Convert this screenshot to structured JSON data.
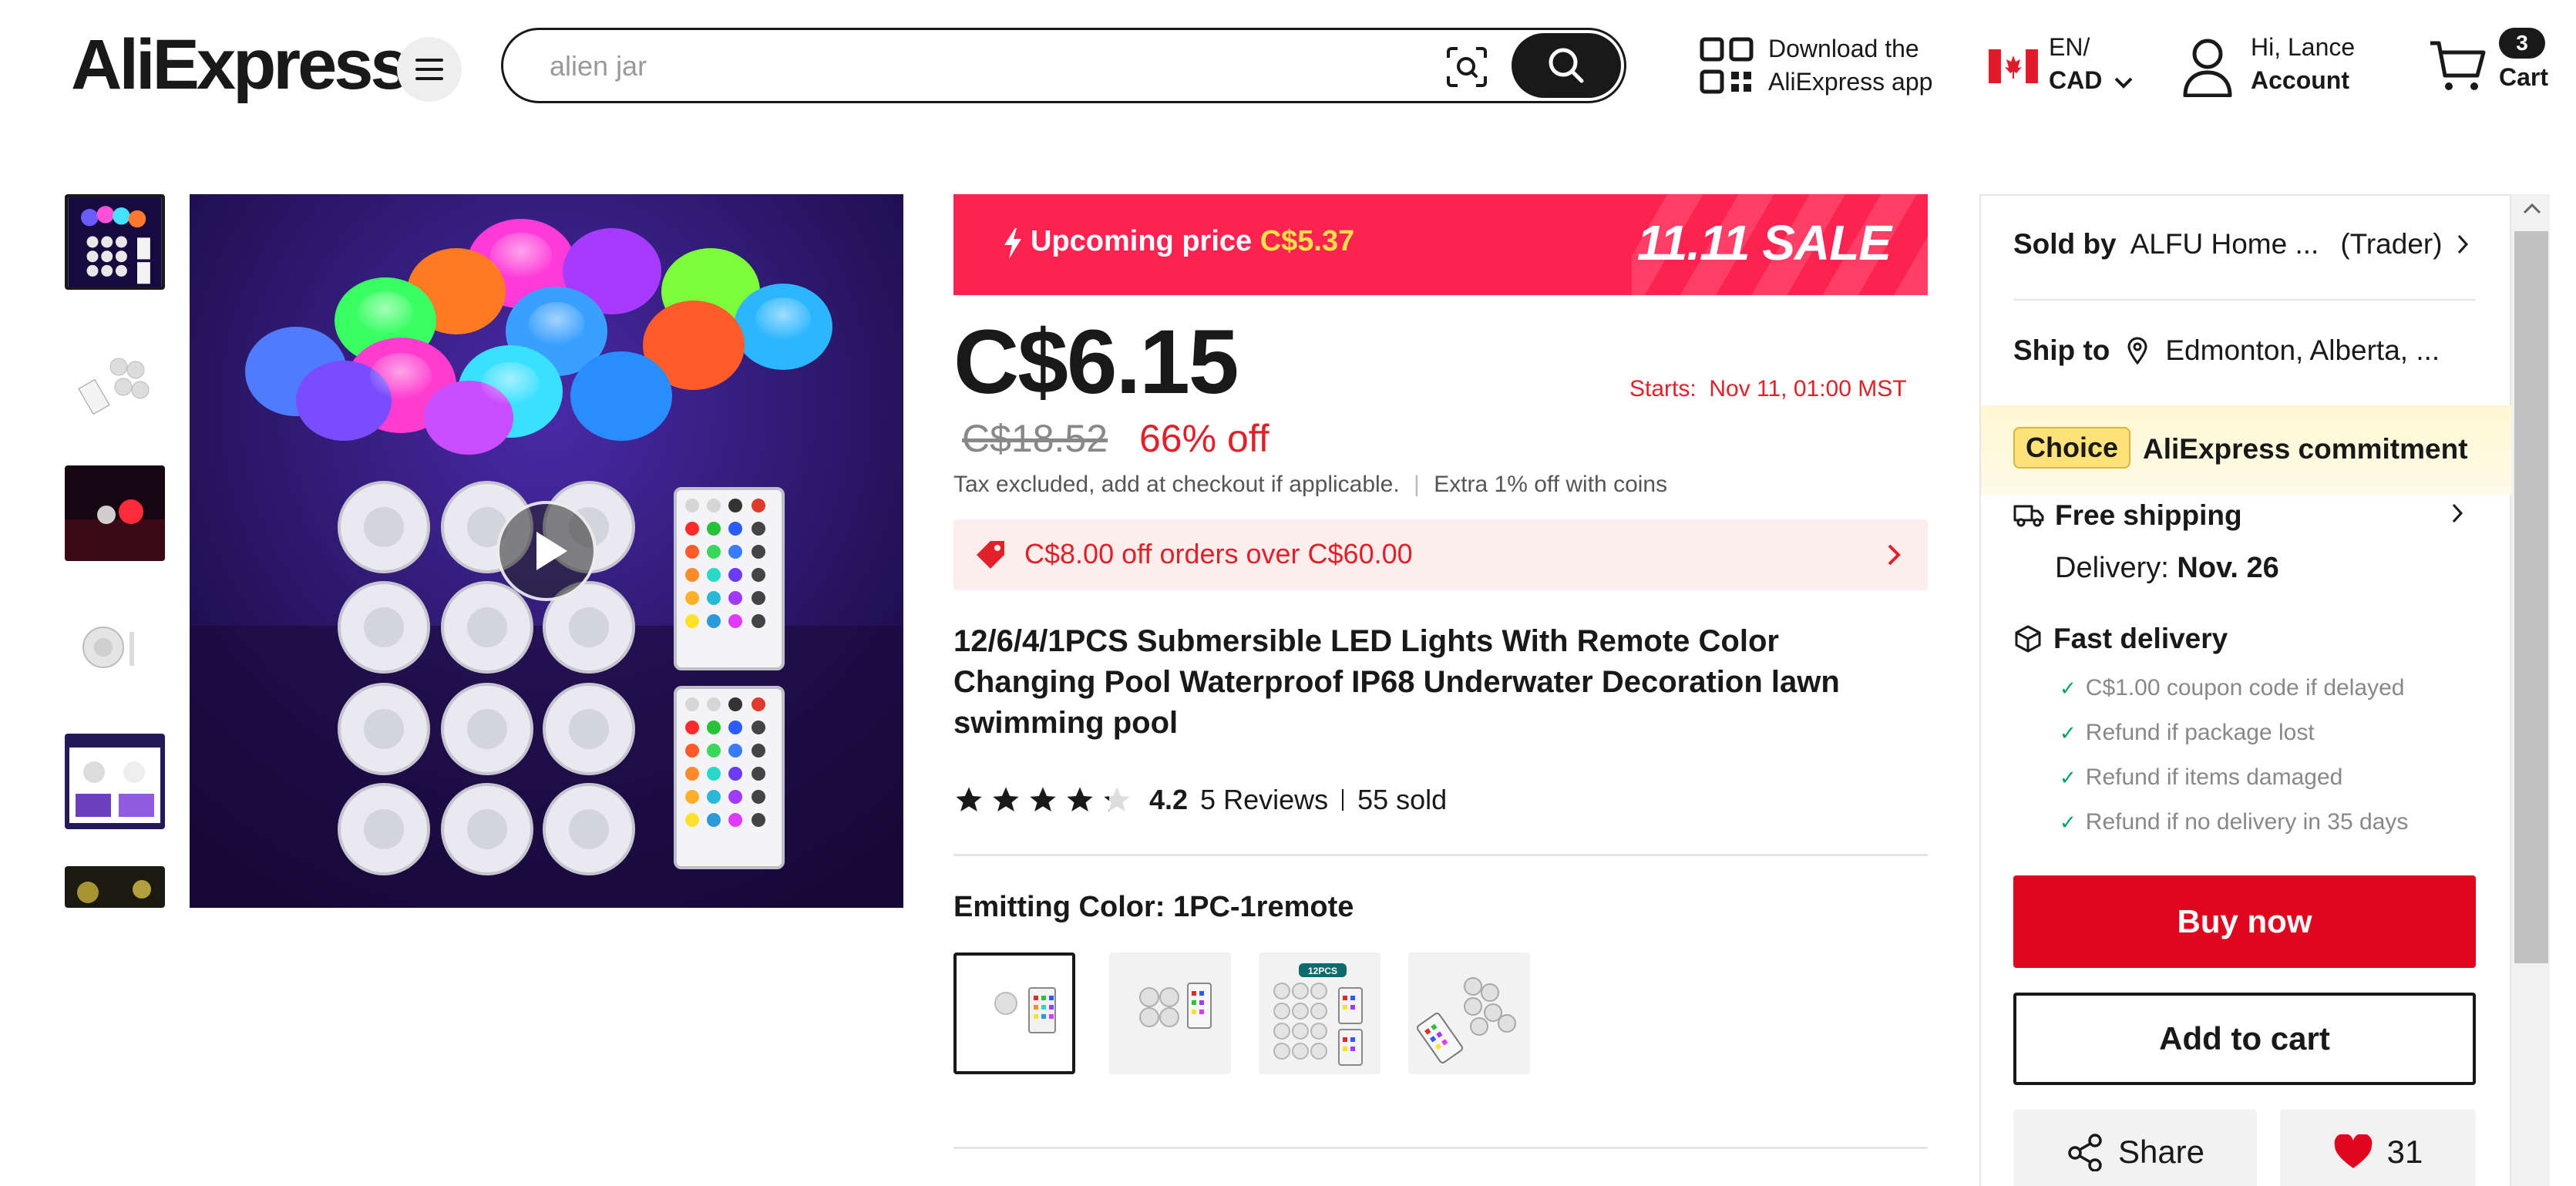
{
  "header": {
    "logo_text": "AliExpress",
    "menu_icon": "hamburger-menu-icon",
    "search": {
      "placeholder": "alien jar",
      "scan_icon": "image-search-icon",
      "button_icon": "search-icon"
    },
    "app_download": {
      "line1": "Download the",
      "line2": "AliExpress app",
      "icon": "qr-code-icon"
    },
    "locale": {
      "lang": "EN/",
      "currency": "CAD",
      "flag": "canada-flag-icon"
    },
    "account": {
      "greeting": "Hi, Lance",
      "label": "Account",
      "icon": "user-icon"
    },
    "cart": {
      "count": "3",
      "label": "Cart",
      "icon": "cart-icon"
    }
  },
  "gallery": {
    "thumbnails": [
      "thumb-1",
      "thumb-2",
      "thumb-3",
      "thumb-4",
      "thumb-5",
      "thumb-6"
    ],
    "active_index": 0,
    "play_icon": "play-icon"
  },
  "product": {
    "sale_banner": {
      "label": "Upcoming price",
      "price": "C$5.37",
      "event": "11.11 SALE"
    },
    "price": "C$6.15",
    "starts": "Starts:  Nov 11, 01:00 MST",
    "original_price": "C$18.52",
    "discount": "66% off",
    "tax_note": "Tax excluded, add at checkout if applicable.",
    "coins_note": "Extra 1% off with coins",
    "coupon": "C$8.00 off orders over C$60.00",
    "title": "12/6/4/1PCS Submersible LED Lights With Remote Color Changing Pool Waterproof IP68 Underwater Decoration lawn swimming pool",
    "rating": "4.2",
    "rating_value": 4.2,
    "reviews": "5 Reviews",
    "sold": "55 sold",
    "color_label": "Emitting Color: 1PC-1remote",
    "swatch_badge": "12PCS",
    "swatches": [
      "1PC-1remote",
      "4PCS",
      "12PCS",
      "6PCS"
    ],
    "selected_swatch": 0
  },
  "panel": {
    "sold_by_label": "Sold by",
    "seller": "ALFU Home ...",
    "seller_type": "(Trader)",
    "ship_to_label": "Ship to",
    "ship_to": "Edmonton, Alberta, ...",
    "choice_badge": "Choice",
    "choice_text": "AliExpress commitment",
    "free_shipping": "Free shipping",
    "delivery_label": "Delivery:",
    "delivery_date": "Nov. 26",
    "fast_delivery": "Fast delivery",
    "guarantees": [
      "C$1.00 coupon code if delayed",
      "Refund if package lost",
      "Refund if items damaged",
      "Refund if no delivery in 35 days"
    ],
    "buy_now": "Buy now",
    "add_to_cart": "Add to cart",
    "share": "Share",
    "wishlist_count": "31"
  },
  "colors": {
    "brand_red": "#e0061e",
    "sale_pink": "#fd2350",
    "price_red": "#e1202a",
    "choice_yellow": "#ffe27a",
    "check_green": "#00a06a"
  }
}
